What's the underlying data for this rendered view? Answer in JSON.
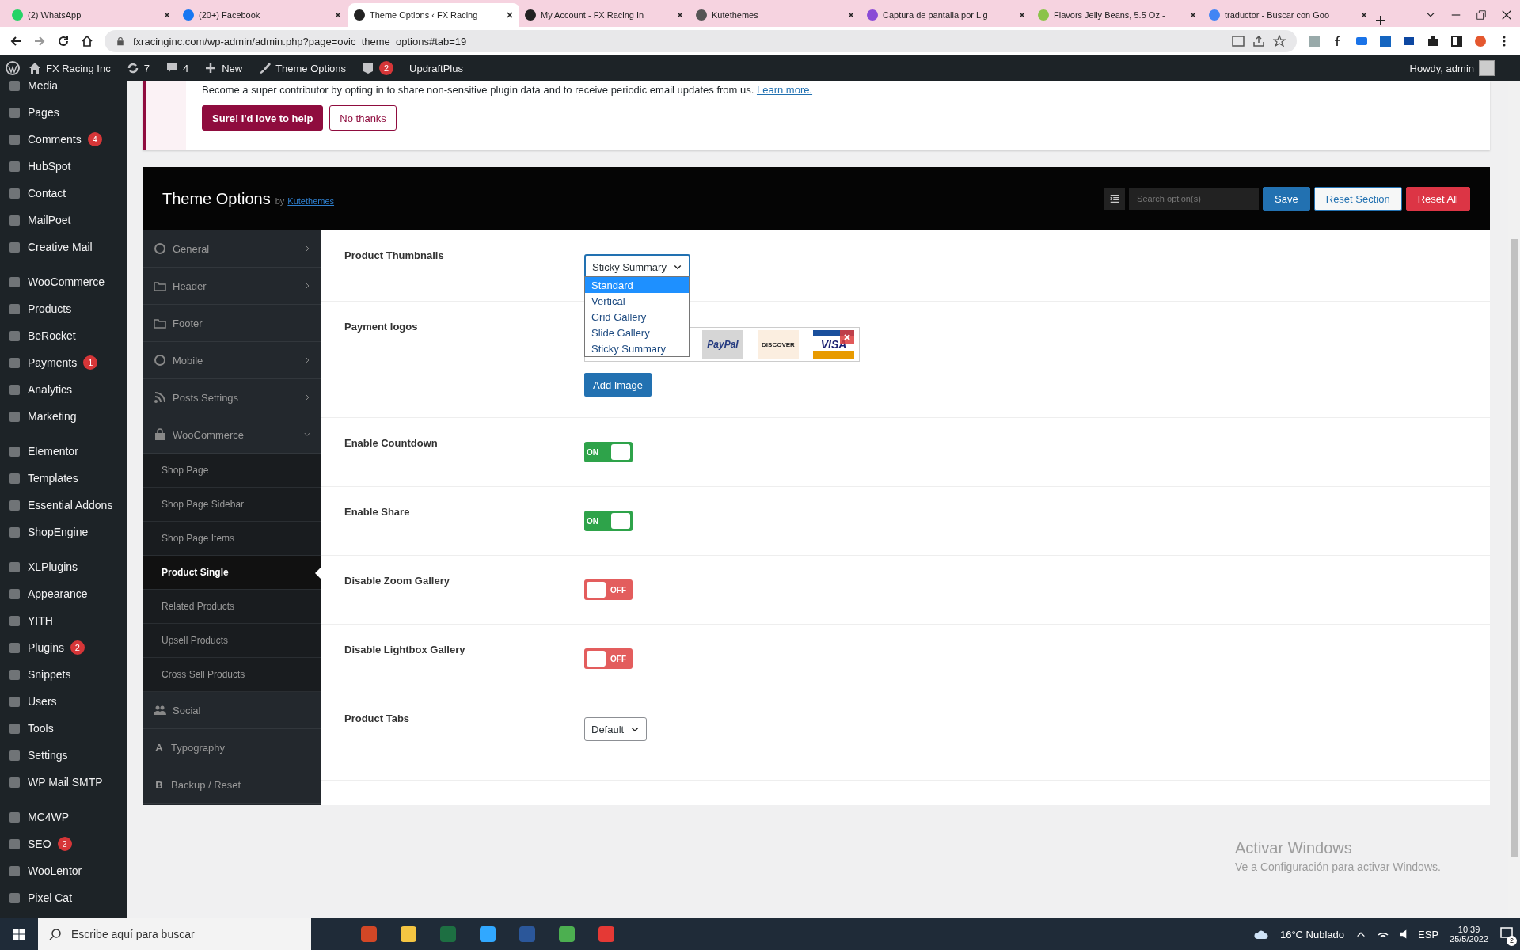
{
  "browser": {
    "tabs": [
      {
        "title": "(2) WhatsApp",
        "selected": false
      },
      {
        "title": "(20+) Facebook",
        "selected": false
      },
      {
        "title": "Theme Options ‹ FX Racing",
        "selected": true
      },
      {
        "title": "My Account - FX Racing In",
        "selected": false
      },
      {
        "title": "Kutethemes",
        "selected": false
      },
      {
        "title": "Captura de pantalla por Lig",
        "selected": false
      },
      {
        "title": "Flavors Jelly Beans, 5.5 Oz -",
        "selected": false
      },
      {
        "title": "traductor - Buscar con Goo",
        "selected": false
      }
    ],
    "address": "fxracinginc.com/wp-admin/admin.php?page=ovic_theme_options#tab=19"
  },
  "admin_bar": {
    "items": [
      {
        "label": "FX Racing Inc"
      },
      {
        "label": "7"
      },
      {
        "label": "4"
      },
      {
        "label": "New"
      },
      {
        "label": "Theme Options"
      },
      {
        "badge": "2"
      },
      {
        "label": "UpdraftPlus"
      }
    ],
    "greeting": "Howdy, admin"
  },
  "sidebar": {
    "groups": [
      {
        "items": [
          {
            "label": "Media"
          },
          {
            "label": "Pages"
          },
          {
            "label": "Comments",
            "badge": "4"
          },
          {
            "label": "HubSpot"
          },
          {
            "label": "Contact"
          },
          {
            "label": "MailPoet"
          },
          {
            "label": "Creative Mail"
          }
        ]
      },
      {
        "items": [
          {
            "label": "WooCommerce"
          },
          {
            "label": "Products"
          },
          {
            "label": "BeRocket"
          },
          {
            "label": "Payments",
            "badge": "1"
          },
          {
            "label": "Analytics"
          },
          {
            "label": "Marketing"
          }
        ]
      },
      {
        "items": [
          {
            "label": "Elementor"
          },
          {
            "label": "Templates"
          },
          {
            "label": "Essential Addons"
          },
          {
            "label": "ShopEngine"
          }
        ]
      },
      {
        "items": [
          {
            "label": "XLPlugins"
          },
          {
            "label": "Appearance"
          },
          {
            "label": "YITH"
          },
          {
            "label": "Plugins",
            "badge": "2"
          },
          {
            "label": "Snippets"
          },
          {
            "label": "Users"
          },
          {
            "label": "Tools"
          },
          {
            "label": "Settings"
          },
          {
            "label": "WP Mail SMTP"
          }
        ]
      },
      {
        "items": [
          {
            "label": "MC4WP"
          },
          {
            "label": "SEO",
            "badge": "2"
          },
          {
            "label": "WooLentor"
          },
          {
            "label": "Pixel Cat"
          }
        ]
      }
    ]
  },
  "notice": {
    "text": "Become a super contributor by opting in to share non-sensitive plugin data and to receive periodic email updates from us.",
    "link": "Learn more.",
    "buttons": [
      {
        "label": "Sure! I'd love to help",
        "kind": "primary"
      },
      {
        "label": "No thanks",
        "kind": "secondary"
      }
    ]
  },
  "theme_options": {
    "title": "Theme Options",
    "by": "by",
    "author": "Kutethemes",
    "search": {
      "placeholder": "Search option(s)"
    },
    "buttons": [
      {
        "label": "Save",
        "kind": "save"
      },
      {
        "label": "Reset Section",
        "kind": "reset"
      },
      {
        "label": "Reset All",
        "kind": "danger"
      }
    ],
    "nav": [
      {
        "label": "General",
        "arrow": true,
        "expanded": false
      },
      {
        "label": "Header",
        "arrow": true,
        "expanded": false
      },
      {
        "label": "Footer",
        "arrow": false
      },
      {
        "label": "Mobile",
        "arrow": true,
        "expanded": false
      },
      {
        "label": "Posts Settings",
        "arrow": true,
        "expanded": false
      },
      {
        "label": "WooCommerce",
        "arrow": true,
        "expanded": true,
        "children": [
          {
            "label": "Shop Page",
            "selected": false
          },
          {
            "label": "Shop Page Sidebar",
            "selected": false
          },
          {
            "label": "Shop Page Items",
            "selected": false
          },
          {
            "label": "Product Single",
            "selected": true
          },
          {
            "label": "Related Products",
            "selected": false
          },
          {
            "label": "Upsell Products",
            "selected": false
          },
          {
            "label": "Cross Sell Products",
            "selected": false
          }
        ]
      },
      {
        "label": "Social",
        "arrow": false
      },
      {
        "label": "Typography",
        "glyph": "A",
        "arrow": false
      },
      {
        "label": "Backup / Reset",
        "glyph": "B",
        "arrow": false
      }
    ],
    "fields": [
      {
        "kind": "select",
        "label": "Product Thumbnails",
        "value": "Sticky Summary",
        "options": [
          {
            "label": "Standard",
            "highlighted": true
          },
          {
            "label": "Vertical",
            "highlighted": false
          },
          {
            "label": "Grid Gallery",
            "highlighted": false
          },
          {
            "label": "Slide Gallery",
            "highlighted": false
          },
          {
            "label": "Sticky Summary",
            "highlighted": false
          }
        ]
      },
      {
        "kind": "gallery",
        "label": "Payment logos",
        "logos": [
          {
            "label": "PayPal"
          },
          {
            "label": "DISCOVER"
          },
          {
            "label": "VISA"
          }
        ],
        "button": "Add Image"
      },
      {
        "kind": "toggle",
        "label": "Enable Countdown",
        "on": true,
        "state_label": "ON"
      },
      {
        "kind": "toggle",
        "label": "Enable Share",
        "on": true,
        "state_label": "ON"
      },
      {
        "kind": "toggle",
        "label": "Disable Zoom Gallery",
        "on": false,
        "state_label": "OFF"
      },
      {
        "kind": "toggle",
        "label": "Disable Lightbox Gallery",
        "on": false,
        "state_label": "OFF"
      },
      {
        "kind": "select",
        "label": "Product Tabs",
        "value": "Default"
      }
    ]
  },
  "watermark": {
    "title": "Activar Windows",
    "text": "Ve a Configuración para activar Windows."
  },
  "taskbar": {
    "search": {
      "placeholder": "Escribe aquí para buscar"
    },
    "weather": "16°C  Nublado",
    "language": "ESP",
    "time": "10:39",
    "date": "25/5/2022",
    "notifications": "2"
  }
}
